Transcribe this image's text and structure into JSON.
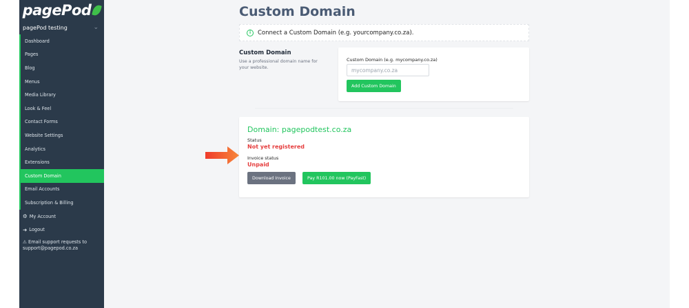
{
  "sidebar": {
    "logo": "pagePod",
    "site_name": "pagePod testing",
    "items": [
      {
        "label": "Dashboard"
      },
      {
        "label": "Pages"
      },
      {
        "label": "Blog"
      },
      {
        "label": "Menus"
      },
      {
        "label": "Media Library"
      },
      {
        "label": "Look & Feel"
      },
      {
        "label": "Contact Forms"
      },
      {
        "label": "Website Settings"
      },
      {
        "label": "Analytics"
      },
      {
        "label": "Extensions"
      },
      {
        "label": "Custom Domain"
      },
      {
        "label": "Email Accounts"
      },
      {
        "label": "Subscription & Billing"
      }
    ],
    "my_account": "My Account",
    "logout": "Logout",
    "support": "Email support requests to support@pagepod.co.za",
    "active_item": "Custom Domain"
  },
  "main": {
    "title": "Custom Domain",
    "alert": "Connect a Custom Domain (e.g. yourcompany.co.za).",
    "section": {
      "title": "Custom Domain",
      "description": "Use a professional domain name for your website."
    },
    "form": {
      "label": "Custom Domain (e.g. mycompany.co.za)",
      "placeholder": "mycompany.co.za",
      "button": "Add Custom Domain"
    },
    "domain": {
      "title": "Domain: pagepodtest.co.za",
      "status_label": "Status",
      "status_value": "Not yet registered",
      "invoice_label": "Invoice status",
      "invoice_value": "Unpaid",
      "download_button": "Download Invoice",
      "pay_button": "Pay R101.00 now (PayFast)"
    }
  },
  "colors": {
    "sidebar_bg": "#2b3a4a",
    "accent": "#22c55e",
    "title": "#4a5b74",
    "error": "#e53e3e"
  },
  "icons": [
    "info-icon",
    "gear-icon",
    "logout-icon",
    "warning-icon",
    "chevron-down-icon",
    "arrow-icon",
    "leaf-icon"
  ]
}
